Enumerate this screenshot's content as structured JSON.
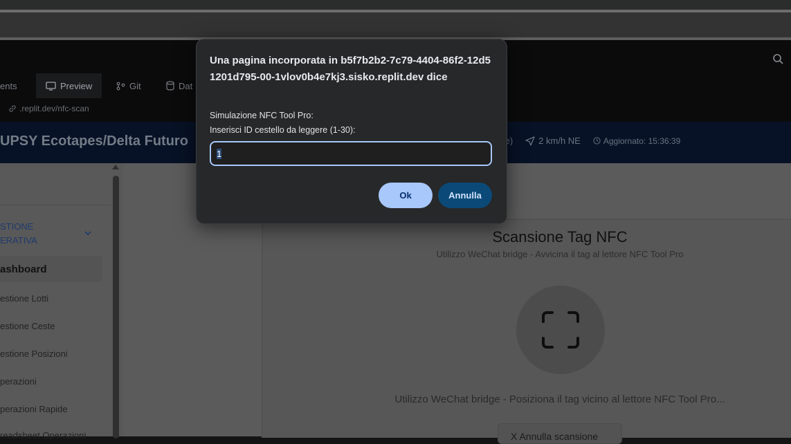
{
  "workspace": {
    "tabs": [
      {
        "label": "ents"
      },
      {
        "label": "Preview"
      },
      {
        "label": "Git"
      },
      {
        "label": "Dat"
      }
    ],
    "url": ".replit.dev/nfc-scan"
  },
  "app": {
    "title": "UPSY Ecotapes/Delta Futuro",
    "weather_fragment": "te)",
    "wind": "2 km/h NE",
    "updated": "Aggiornato: 15:36:39"
  },
  "sidebar": {
    "group_label_line1": "STIONE",
    "group_label_line2": "ERATIVA",
    "items": [
      {
        "label": "ashboard"
      },
      {
        "label": "estione Lotti"
      },
      {
        "label": "estione Ceste"
      },
      {
        "label": "estione Posizioni"
      },
      {
        "label": "perazioni"
      },
      {
        "label": "perazioni Rapide"
      },
      {
        "label": "readsheet Operazioni"
      }
    ]
  },
  "main": {
    "title": "Scansione Tag NFC",
    "subtitle": "Utilizzo WeChat bridge - Avvicina il tag al lettore NFC Tool Pro",
    "hint": "Utilizzo WeChat bridge - Posiziona il tag vicino al lettore NFC Tool Pro...",
    "button": "X  Annulla scansione"
  },
  "dialog": {
    "title": "Una pagina incorporata in b5f7b2b2-7c79-4404-86f2-12d51201d795-00-1vlov0b4e7kj3.sisko.replit.dev dice",
    "message_line1": "Simulazione NFC Tool Pro:",
    "message_line2": "Inserisci ID cestello da leggere (1-30):",
    "input_value": "1",
    "ok_label": "Ok",
    "cancel_label": "Annulla"
  },
  "colors": {
    "accent": "#a8c7fa",
    "cancel_bg": "#0b4a78",
    "dialog_bg": "#27282a"
  }
}
